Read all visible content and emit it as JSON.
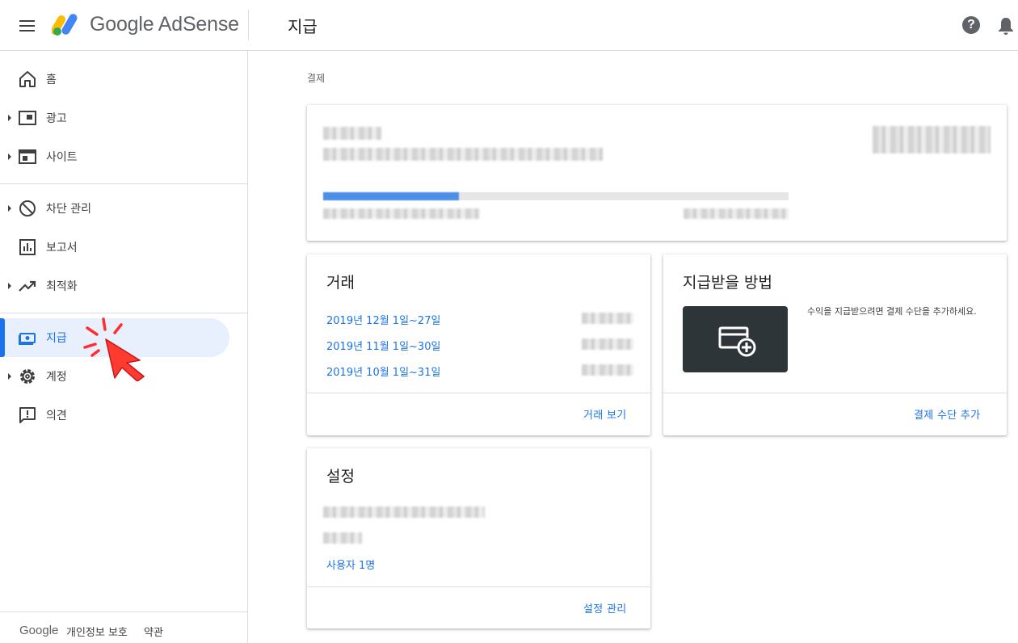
{
  "header": {
    "logo_text": "Google AdSense",
    "title": "지급"
  },
  "sidebar": {
    "items": [
      {
        "label": "홈",
        "icon": "home-icon",
        "caret": false
      },
      {
        "label": "광고",
        "icon": "ads-icon",
        "caret": true
      },
      {
        "label": "사이트",
        "icon": "sites-icon",
        "caret": true
      },
      {
        "label": "차단 관리",
        "icon": "block-icon",
        "caret": true
      },
      {
        "label": "보고서",
        "icon": "reports-icon",
        "caret": false
      },
      {
        "label": "최적화",
        "icon": "optimize-icon",
        "caret": true
      },
      {
        "label": "지급",
        "icon": "payments-icon",
        "caret": false,
        "active": true
      },
      {
        "label": "계정",
        "icon": "gear-icon",
        "caret": true
      },
      {
        "label": "의견",
        "icon": "feedback-icon",
        "caret": false
      }
    ],
    "footer": {
      "brand": "Google",
      "privacy": "개인정보 보호",
      "terms": "약관"
    }
  },
  "main": {
    "breadcrumb": "결제",
    "transactions": {
      "title": "거래",
      "rows": [
        {
          "period": "2019년 12월 1일~27일"
        },
        {
          "period": "2019년 11월 1일~30일"
        },
        {
          "period": "2019년 10월 1일~31일"
        }
      ],
      "action": "거래 보기"
    },
    "payment_method": {
      "title": "지급받을 방법",
      "description": "수익을 지급받으려면 결제 수단을 추가하세요.",
      "action": "결제 수단 추가"
    },
    "settings": {
      "title": "설정",
      "users_link": "사용자 1명",
      "action": "설정 관리"
    }
  },
  "colors": {
    "accent": "#1a73e8",
    "active_bg": "#e8f0fe",
    "cursor_red": "#ff3b30"
  }
}
